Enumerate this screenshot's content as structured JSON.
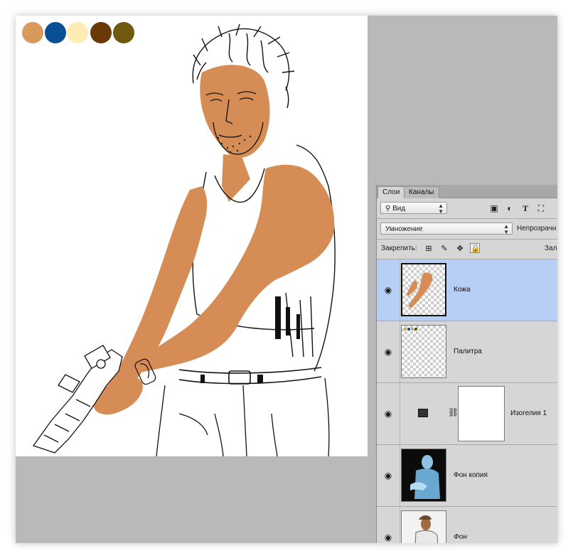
{
  "canvas": {
    "swatches": [
      "#d89a5c",
      "#0a4f95",
      "#fdedb4",
      "#693a06",
      "#6d5a0c"
    ],
    "skin_color": "#d68c55"
  },
  "layers_panel": {
    "tabs": [
      "Слои",
      "Каналы"
    ],
    "filter": {
      "value": "Вид"
    },
    "filter_icons": [
      "image-filter-icon",
      "adjustment-filter-icon",
      "type-filter-icon",
      "shape-filter-icon"
    ],
    "blend_mode": "Умножение",
    "opacity_label": "Непрозрачн",
    "lock_label": "Закрепить:",
    "fill_label": "Зал",
    "layers": [
      {
        "name": "Кожа",
        "selected": true,
        "italic": false
      },
      {
        "name": "Палитра",
        "selected": false,
        "italic": false
      },
      {
        "name": "Изогелия 1",
        "selected": false,
        "italic": false
      },
      {
        "name": "Фон копия",
        "selected": false,
        "italic": false
      },
      {
        "name": "Фон",
        "selected": false,
        "italic": true
      }
    ]
  }
}
